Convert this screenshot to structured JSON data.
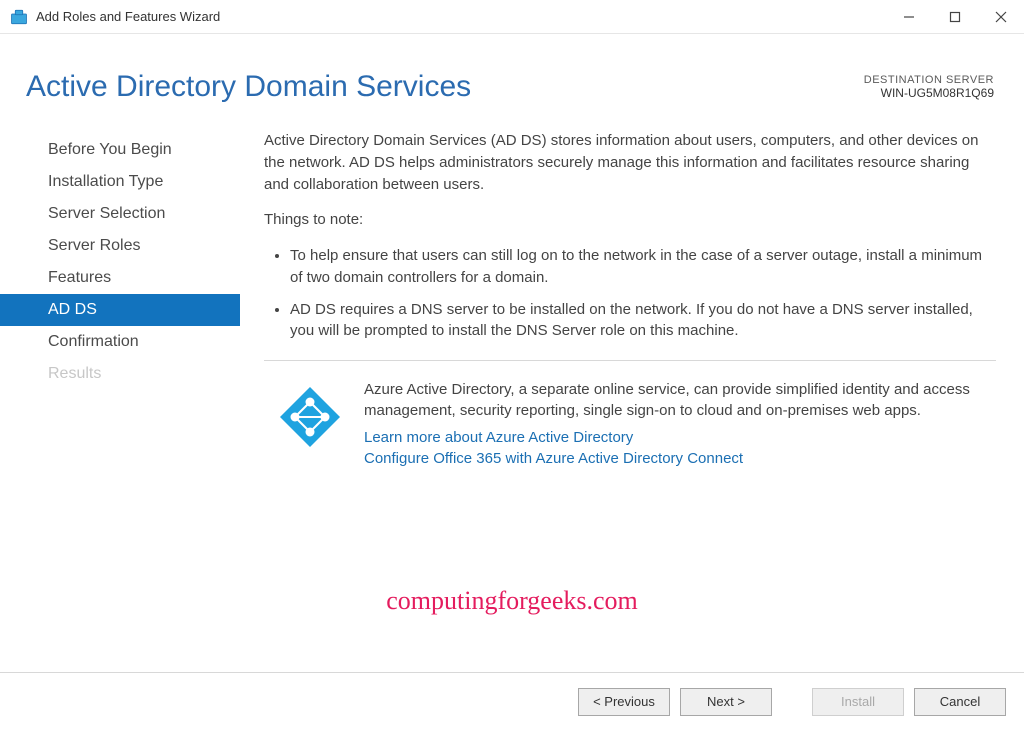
{
  "window": {
    "title": "Add Roles and Features Wizard"
  },
  "header": {
    "page_title": "Active Directory Domain Services",
    "destination_label": "DESTINATION SERVER",
    "destination_server": "WIN-UG5M08R1Q69"
  },
  "sidebar": {
    "steps": [
      {
        "label": "Before You Begin",
        "active": false,
        "disabled": false
      },
      {
        "label": "Installation Type",
        "active": false,
        "disabled": false
      },
      {
        "label": "Server Selection",
        "active": false,
        "disabled": false
      },
      {
        "label": "Server Roles",
        "active": false,
        "disabled": false
      },
      {
        "label": "Features",
        "active": false,
        "disabled": false
      },
      {
        "label": "AD DS",
        "active": true,
        "disabled": false
      },
      {
        "label": "Confirmation",
        "active": false,
        "disabled": false
      },
      {
        "label": "Results",
        "active": false,
        "disabled": true
      }
    ]
  },
  "content": {
    "intro": "Active Directory Domain Services (AD DS) stores information about users, computers, and other devices on the network.  AD DS helps administrators securely manage this information and facilitates resource sharing and collaboration between users.",
    "note_heading": "Things to note:",
    "bullets": [
      "To help ensure that users can still log on to the network in the case of a server outage, install a minimum of two domain controllers for a domain.",
      "AD DS requires a DNS server to be installed on the network.  If you do not have a DNS server installed, you will be prompted to install the DNS Server role on this machine."
    ],
    "azure": {
      "text": "Azure Active Directory, a separate online service, can provide simplified identity and access management, security reporting, single sign-on to cloud and on-premises web apps.",
      "link1": "Learn more about Azure Active Directory",
      "link2": "Configure Office 365 with Azure Active Directory Connect"
    }
  },
  "watermark": "computingforgeeks.com",
  "footer": {
    "previous": "< Previous",
    "next": "Next >",
    "install": "Install",
    "cancel": "Cancel"
  }
}
